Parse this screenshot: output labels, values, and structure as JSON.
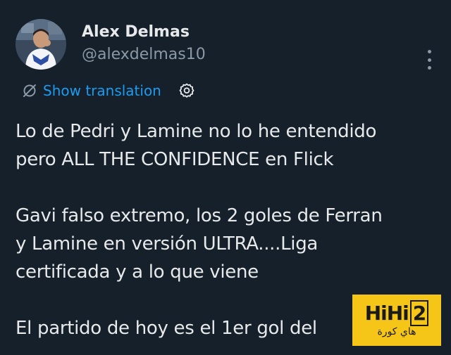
{
  "author": {
    "display_name": "Alex Delmas",
    "handle": "@alexdelmas10"
  },
  "translate": {
    "label": "Show translation"
  },
  "tweet_body": {
    "paragraph1": [
      "Lo de Pedri y Lamine no lo he entendido",
      "pero ALL THE CONFIDENCE en Flick"
    ],
    "paragraph2": [
      "Gavi falso extremo, los 2 goles de Ferran",
      "y Lamine en versión ULTRA....Liga",
      "certificada y a lo que viene"
    ],
    "paragraph3": [
      "El partido de hoy es el 1er gol del"
    ]
  },
  "watermark": {
    "text_en_a": "HiHi",
    "text_en_b": "2",
    "text_ar": "هاي كورة"
  },
  "colors": {
    "background": "#15202b",
    "text_primary": "#e7e9ea",
    "text_secondary": "#8b98a5",
    "link": "#1d9bf0",
    "watermark_bg": "#f5c518"
  },
  "icons": {
    "translate": "translate-icon",
    "settings": "gear-icon",
    "more": "more-options-icon"
  }
}
